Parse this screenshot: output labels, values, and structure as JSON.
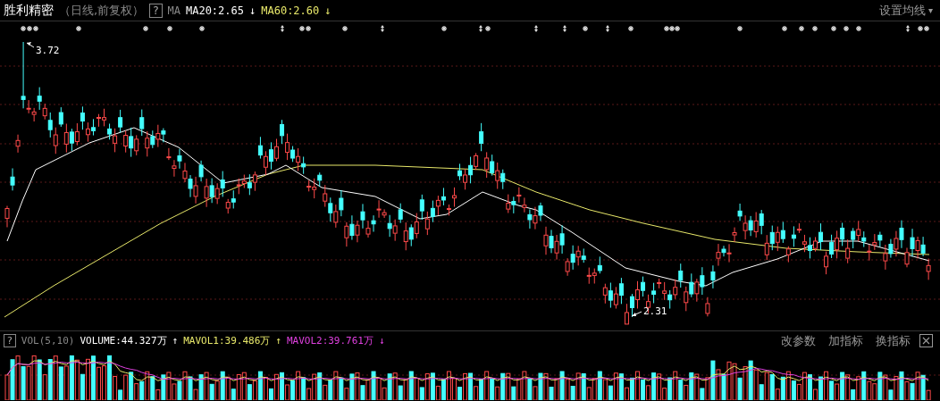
{
  "header": {
    "stock_name": "胜利精密",
    "period": "（日线,前复权）",
    "help": "?",
    "indicator": "MA",
    "lines": [
      {
        "label": "MA20:2.65",
        "arrow": "↓",
        "color": "#ffffff"
      },
      {
        "label": "MA60:2.60",
        "arrow": "↓",
        "color": "#e8e86a"
      }
    ],
    "settings": "设置均线",
    "settings_caret": "▾"
  },
  "price_chart": {
    "high_label": "3.72",
    "low_label": "2.31"
  },
  "volume_panel": {
    "help": "?",
    "indicator": "VOL(5,10)",
    "lines": [
      {
        "label": "VOLUME:44.327万",
        "arrow": "↑",
        "color": "#ffffff"
      },
      {
        "label": "MAVOL1:39.486万",
        "arrow": "↑",
        "color": "#e8e86a"
      },
      {
        "label": "MAVOL2:39.761万",
        "arrow": "↓",
        "color": "#e040e0"
      }
    ],
    "actions": [
      "改参数",
      "加指标",
      "换指标"
    ]
  }
}
